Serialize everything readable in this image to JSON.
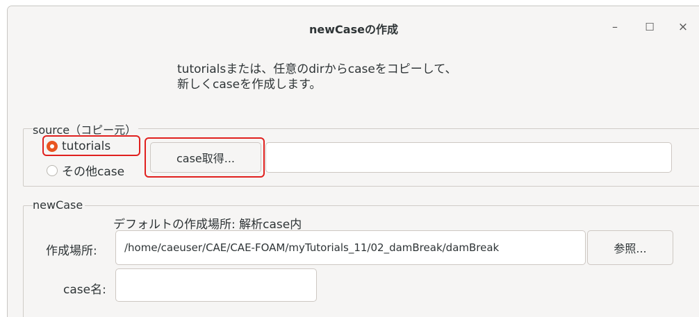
{
  "window": {
    "title": "newCaseの作成",
    "controls": {
      "minimize": "–",
      "maximize": "☐",
      "close": "×"
    }
  },
  "description": {
    "line1": "tutorialsまたは、任意のdirからcaseをコピーして、",
    "line2": "新しくcaseを作成します。"
  },
  "source": {
    "legend": "source（コピー元）",
    "options": [
      {
        "label": "tutorials",
        "selected": true
      },
      {
        "label": "その他case",
        "selected": false
      }
    ],
    "get_case_button": "case取得...",
    "path_value": ""
  },
  "newcase": {
    "legend": "newCase",
    "default_hint": "デフォルトの作成場所: 解析case内",
    "location_label": "作成場所:",
    "location_value": "/home/caeuser/CAE/CAE-FOAM/myTutorials_11/02_damBreak/damBreak",
    "browse_button": "参照...",
    "name_label": "case名:",
    "name_value": ""
  },
  "colors": {
    "accent": "#e95420",
    "highlight": "#e0201e",
    "window_bg": "#f6f5f4"
  }
}
